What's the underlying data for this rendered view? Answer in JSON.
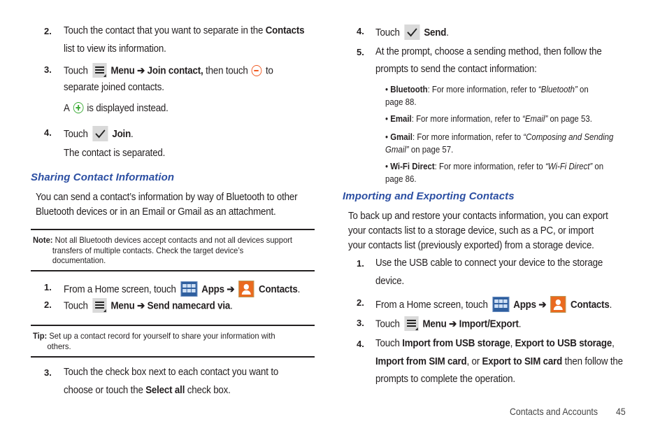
{
  "left": {
    "steps_top": [
      {
        "num": "2.",
        "line1_pre": "Touch the contact that you want to separate in the ",
        "line1_bold": "Contacts",
        "line2": "list to view its information."
      },
      {
        "num": "3.",
        "pre": "Touch ",
        "menu_label": "Menu",
        "arrow": "➔",
        "bold2": "Join contact,",
        "mid": " then touch ",
        "post": " to",
        "line2": "separate joined contacts.",
        "sub_pre": "A ",
        "sub_post": " is displayed instead."
      },
      {
        "num": "4.",
        "pre": "Touch ",
        "bold": "Join",
        "post": ".",
        "sub": "The contact is separated."
      }
    ],
    "section_heading": "Sharing Contact Information",
    "intro_line1": "You can send a contact’s information by way of Bluetooth to other",
    "intro_line2": "Bluetooth devices or in an Email or Gmail as an attachment.",
    "note": {
      "label": "Note:",
      "line1": " Not all Bluetooth devices accept contacts and not all devices support",
      "line2": "transfers of multiple contacts. Check the target device’s",
      "line3": "documentation."
    },
    "steps_mid": [
      {
        "num": "1.",
        "pre": "From a Home screen, touch ",
        "apps": "Apps",
        "arrow": "➔",
        "contacts": "Contacts",
        "post": "."
      },
      {
        "num": "2.",
        "pre": "Touch ",
        "menu": "Menu",
        "arrow": "➔",
        "bold2": "Send namecard via",
        "post": "."
      }
    ],
    "tip": {
      "label": "Tip:",
      "line1": " Set up a contact record for yourself to share your information with",
      "line2": "others."
    },
    "step_bottom": {
      "num": "3.",
      "line1": "Touch the check box next to each contact you want to",
      "line2_pre": "choose or touch the ",
      "line2_bold": "Select all",
      "line2_post": " check box."
    }
  },
  "right": {
    "step4": {
      "num": "4.",
      "pre": "Touch ",
      "bold": "Send",
      "post": "."
    },
    "step5": {
      "num": "5.",
      "line1": "At the prompt, choose a sending method, then follow the",
      "line2": "prompts to send the contact information:"
    },
    "bullets": [
      {
        "bold": "Bluetooth",
        "text": ": For more information, refer to ",
        "ref": "“Bluetooth”",
        "after": "  on",
        "line2": "page 88."
      },
      {
        "bold": "Email",
        "text": ": For more information, refer to ",
        "ref": "“Email”",
        "after": "  on page 53.",
        "line2": ""
      },
      {
        "bold": "Gmail",
        "text": ": For more information, refer to ",
        "ref": "“Composing and Sending",
        "after": "",
        "line2_ref": "Gmail”",
        "line2": "  on page 57."
      },
      {
        "bold": "Wi-Fi Direct",
        "text": ": For more information, refer to ",
        "ref": "“Wi-Fi Direct”",
        "after": "  on",
        "line2": "page 86."
      }
    ],
    "section_heading": "Importing and Exporting Contacts",
    "intro_line1": "To back up and restore your contacts information, you can export",
    "intro_line2": "your contacts list to a storage device, such as a PC, or import",
    "intro_line3": "your contacts list (previously exported) from a storage device.",
    "steps": [
      {
        "num": "1.",
        "line1": "Use the USB cable to connect your device to the storage",
        "line2": "device."
      },
      {
        "num": "2.",
        "pre": "From a Home screen, touch ",
        "apps": "Apps",
        "arrow": "➔",
        "contacts": "Contacts",
        "post": "."
      },
      {
        "num": "3.",
        "pre": "Touch ",
        "menu": "Menu",
        "arrow": "➔",
        "bold2": "Import/Export",
        "post": "."
      },
      {
        "num": "4.",
        "pre": "Touch ",
        "b1": "Import from USB storage",
        "s1": ", ",
        "b2": "Export to USB storage",
        "s2": ",",
        "b3": "Import from SIM card",
        "s3": ", or ",
        "b4": "Export to SIM card",
        "s4": " then follow the",
        "line3": "prompts to complete the operation."
      }
    ]
  },
  "footer": {
    "section": "Contacts and Accounts",
    "page": "45"
  },
  "colors": {
    "heading": "#2b4ea2",
    "minus_icon": "#f05a22",
    "plus_icon": "#3aaa35"
  }
}
